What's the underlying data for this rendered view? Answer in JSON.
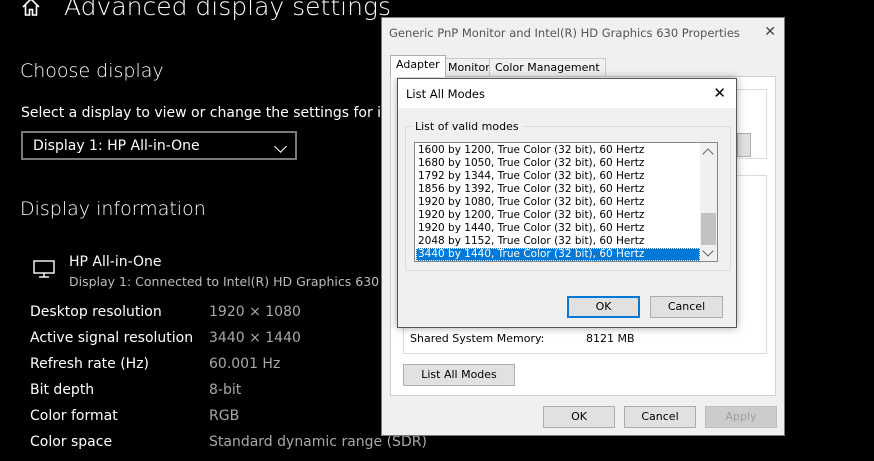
{
  "settings": {
    "title": "Advanced display settings",
    "choose_heading": "Choose display",
    "choose_desc": "Select a display to view or change the settings for it.",
    "display_select_value": "Display 1: HP All-in-One",
    "info_heading": "Display information",
    "monitor_name": "HP All-in-One",
    "monitor_sub": "Display 1: Connected to Intel(R) HD Graphics 630",
    "rows": [
      {
        "label": "Desktop resolution",
        "value": "1920 × 1080"
      },
      {
        "label": "Active signal resolution",
        "value": "3440 × 1440"
      },
      {
        "label": "Refresh rate (Hz)",
        "value": "60.001 Hz"
      },
      {
        "label": "Bit depth",
        "value": "8-bit"
      },
      {
        "label": "Color format",
        "value": "RGB"
      },
      {
        "label": "Color space",
        "value": "Standard dynamic range (SDR)"
      }
    ]
  },
  "properties": {
    "title": "Generic PnP Monitor and Intel(R) HD Graphics 630 Properties",
    "tabs": [
      "Adapter",
      "Monitor",
      "Color Management"
    ],
    "shared_memory_label": "Shared System Memory:",
    "shared_memory_value": "8121 MB",
    "list_all_modes_button": "List All Modes",
    "ok": "OK",
    "cancel": "Cancel",
    "apply": "Apply"
  },
  "modes_dialog": {
    "title": "List All Modes",
    "group_label": "List of valid modes",
    "modes": [
      "1600 by 1200, True Color (32 bit), 60 Hertz",
      "1680 by 1050, True Color (32 bit), 60 Hertz",
      "1792 by 1344, True Color (32 bit), 60 Hertz",
      "1856 by 1392, True Color (32 bit), 60 Hertz",
      "1920 by 1080, True Color (32 bit), 60 Hertz",
      "1920 by 1200, True Color (32 bit), 60 Hertz",
      "1920 by 1440, True Color (32 bit), 60 Hertz",
      "2048 by 1152, True Color (32 bit), 60 Hertz",
      "3440 by 1440, True Color (32 bit), 60 Hertz"
    ],
    "selected_index": 8,
    "ok": "OK",
    "cancel": "Cancel"
  },
  "colors": {
    "accent": "#0078d7",
    "background": "#000000"
  }
}
